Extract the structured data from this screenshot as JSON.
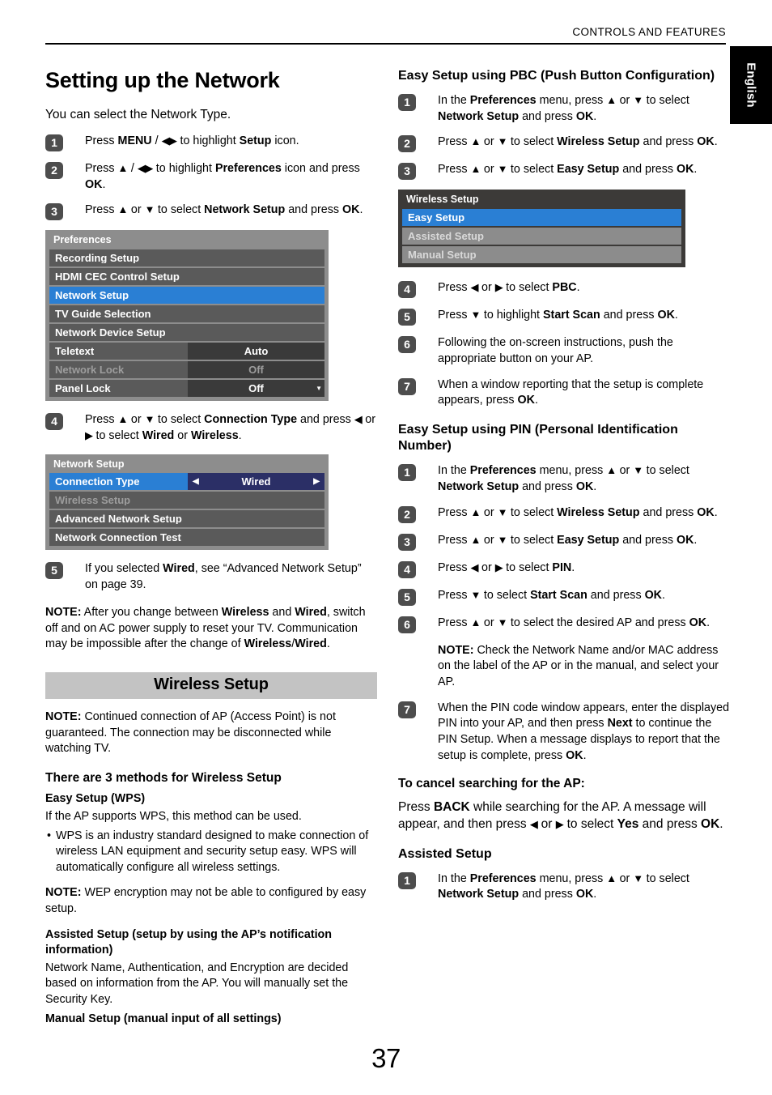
{
  "header": {
    "running_head": "CONTROLS AND FEATURES",
    "language_tab": "English"
  },
  "page_number": "37",
  "left_column": {
    "title": "Setting up the Network",
    "lead": "You can select the Network Type.",
    "steps_1_3": [
      {
        "num": "1",
        "html": "Press <b>MENU</b> / <span class=\"arrow\">◀▶</span> to highlight <b>Setup</b> icon."
      },
      {
        "num": "2",
        "html": "Press <span class=\"arrow\">▲</span> / <span class=\"arrow\">◀▶</span> to highlight <b>Preferences</b> icon and press <b>OK</b>."
      },
      {
        "num": "3",
        "html": "Press <span class=\"arrow\">▲</span> or <span class=\"arrow\">▼</span> to select <b>Network Setup</b> and press <b>OK</b>."
      }
    ],
    "preferences_menu": {
      "title": "Preferences",
      "rows": [
        {
          "label": "Recording Setup",
          "value": "",
          "state": "normal"
        },
        {
          "label": "HDMI CEC Control Setup",
          "value": "",
          "state": "normal"
        },
        {
          "label": "Network Setup",
          "value": "",
          "state": "selected"
        },
        {
          "label": "TV Guide Selection",
          "value": "",
          "state": "normal"
        },
        {
          "label": "Network Device Setup",
          "value": "",
          "state": "normal"
        },
        {
          "label": "Teletext",
          "value": "Auto",
          "state": "normal"
        },
        {
          "label": "Network Lock",
          "value": "Off",
          "state": "dim"
        },
        {
          "label": "Panel Lock",
          "value": "Off",
          "state": "normal"
        }
      ],
      "scroll_caret": "▼"
    },
    "step_4": {
      "num": "4",
      "html": "Press <span class=\"arrow\">▲</span> or <span class=\"arrow\">▼</span> to select <b>Connection Type</b> and press <span class=\"arrow\">◀</span> or <span class=\"arrow\">▶</span> to select <b>Wired</b> or <b>Wireless</b>."
    },
    "network_setup_menu": {
      "title": "Network Setup",
      "rows": [
        {
          "label": "Connection Type",
          "value": "Wired",
          "state": "selected-value"
        },
        {
          "label": "Wireless Setup",
          "value": "",
          "state": "dim"
        },
        {
          "label": "Advanced Network Setup",
          "value": "",
          "state": "normal"
        },
        {
          "label": "Network Connection Test",
          "value": "",
          "state": "normal"
        }
      ],
      "left_caret": "◀",
      "right_caret": "▶"
    },
    "step_5": {
      "num": "5",
      "html": "If you selected <b>Wired</b>, see “Advanced Network Setup” on page 39."
    },
    "note_wired_wireless": "<b>NOTE:</b>  After you change between <b>Wireless</b> and <b>Wired</b>, switch off and on AC power supply to reset your TV. Communication may be impossible after the change of <b>Wireless</b>/<b>Wired</b>.",
    "wireless_setup_banner": "Wireless Setup",
    "note_ap": "<b>NOTE:</b> Continued connection of AP (Access Point) is not guaranteed. The connection may be disconnected while watching TV.",
    "methods_heading": "There are 3 methods for Wireless Setup",
    "easy_setup_wps_heading": "Easy Setup (WPS)",
    "easy_setup_wps_body": "If the AP supports WPS, this method can be used.",
    "easy_setup_wps_bullets": [
      "WPS is an industry standard designed to make connection of wireless LAN equipment and security setup easy. WPS will automatically configure all wireless settings."
    ],
    "note_wep": "<b>NOTE:</b> WEP encryption may not be able to configured by easy setup.",
    "assisted_setup_heading": "Assisted Setup (setup by using the AP’s notification information)",
    "assisted_setup_body": "Network Name, Authentication, and Encryption are decided based on information from the AP. You will manually set the Security Key.",
    "manual_setup_heading": "Manual Setup (manual input of all settings)"
  },
  "right_column": {
    "pbc_heading": "Easy Setup using PBC (Push Button Configuration)",
    "pbc_steps_1_3": [
      {
        "num": "1",
        "html": "In the <b>Preferences</b> menu, press <span class=\"arrow\">▲</span> or <span class=\"arrow\">▼</span> to select <b>Network Setup</b> and press <b>OK</b>."
      },
      {
        "num": "2",
        "html": "Press <span class=\"arrow\">▲</span> or <span class=\"arrow\">▼</span> to select <b>Wireless Setup</b> and press <b>OK</b>."
      },
      {
        "num": "3",
        "html": "Press <span class=\"arrow\">▲</span> or <span class=\"arrow\">▼</span> to select <b>Easy Setup</b> and press <b>OK</b>."
      }
    ],
    "wireless_setup_menu": {
      "title": "Wireless Setup",
      "rows": [
        {
          "label": "Easy Setup",
          "state": "selected"
        },
        {
          "label": "Assisted Setup",
          "state": "grey"
        },
        {
          "label": "Manual Setup",
          "state": "grey"
        }
      ]
    },
    "pbc_steps_4_7": [
      {
        "num": "4",
        "html": "Press <span class=\"arrow\">◀</span> or <span class=\"arrow\">▶</span> to select <b>PBC</b>."
      },
      {
        "num": "5",
        "html": "Press <span class=\"arrow\">▼</span> to highlight <b>Start Scan</b> and press <b>OK</b>."
      },
      {
        "num": "6",
        "html": "Following the on-screen instructions, push the appropriate button on your AP."
      },
      {
        "num": "7",
        "html": "When a window reporting that the setup is complete appears, press <b>OK</b>."
      }
    ],
    "pin_heading": "Easy Setup using PIN (Personal Identification Number)",
    "pin_steps": [
      {
        "num": "1",
        "html": "In the <b>Preferences</b> menu, press <span class=\"arrow\">▲</span> or <span class=\"arrow\">▼</span> to select <b>Network Setup</b> and press <b>OK</b>."
      },
      {
        "num": "2",
        "html": "Press <span class=\"arrow\">▲</span> or <span class=\"arrow\">▼</span> to select <b>Wireless Setup</b> and press <b>OK</b>."
      },
      {
        "num": "3",
        "html": "Press <span class=\"arrow\">▲</span> or <span class=\"arrow\">▼</span> to select <b>Easy Setup</b> and press <b>OK</b>."
      },
      {
        "num": "4",
        "html": "Press <span class=\"arrow\">◀</span> or <span class=\"arrow\">▶</span> to select <b>PIN</b>."
      },
      {
        "num": "5",
        "html": "Press <span class=\"arrow\">▼</span> to select <b>Start Scan</b> and press <b>OK</b>."
      },
      {
        "num": "6",
        "html": "Press <span class=\"arrow\">▲</span> or <span class=\"arrow\">▼</span> to select the desired AP and press <b>OK</b>."
      }
    ],
    "pin_step6_note": "<b>NOTE:</b> Check the Network Name and/or MAC address on the label of the AP or in the manual, and select your AP.",
    "pin_step7": {
      "num": "7",
      "html": "When the PIN code window appears, enter the displayed PIN into your AP, and then press <b>Next</b> to continue the PIN Setup. When a message displays to report that the setup is complete, press <b>OK</b>."
    },
    "cancel_heading": "To cancel searching for the AP:",
    "cancel_body": "Press <b>BACK</b> while searching for the AP. A message will appear, and then press <span class=\"arrow\">◀</span> or <span class=\"arrow\">▶</span> to select <b>Yes</b> and press <b>OK</b>.",
    "assisted_heading": "Assisted Setup",
    "assisted_steps": [
      {
        "num": "1",
        "html": "In the <b>Preferences</b> menu, press <span class=\"arrow\">▲</span> or <span class=\"arrow\">▼</span> to select <b>Network Setup</b> and press <b>OK</b>."
      }
    ]
  },
  "colors": {
    "osd_background": "#8d8d8d",
    "osd_background_dark": "#3c3a38",
    "osd_row": "#5a5a5a",
    "osd_selected": "#2a7fd4",
    "osd_value": "#3a3a3a",
    "osd_value_navy": "#2b2f66",
    "banner": "#c3c3c3",
    "step_badge": "#4d4d4d"
  }
}
